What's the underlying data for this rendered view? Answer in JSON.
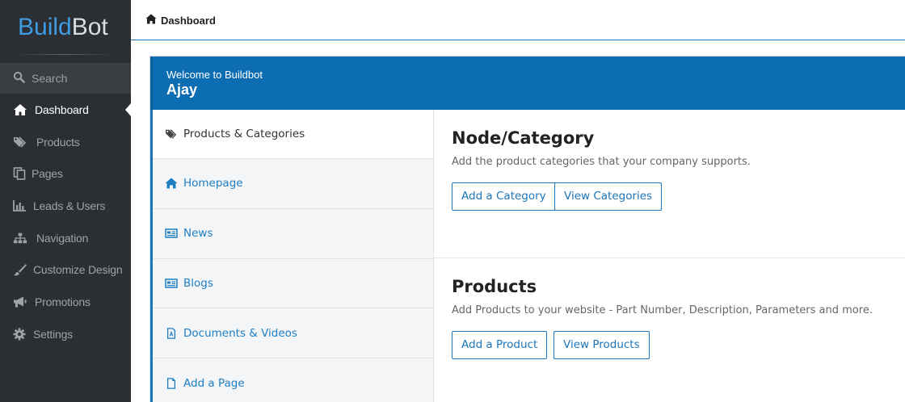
{
  "brand": {
    "part1": "Build",
    "part2": "Bot"
  },
  "colors": {
    "accent": "#1b75bb",
    "header": "#0c6db2",
    "sidebar": "#2b2e33"
  },
  "sidebar": {
    "search_label": "Search",
    "items": [
      {
        "label": "Dashboard",
        "icon": "home-icon",
        "active": true
      },
      {
        "label": "Products",
        "icon": "tags-icon"
      },
      {
        "label": "Pages",
        "icon": "copy-icon"
      },
      {
        "label": "Leads & Users",
        "icon": "bar-chart-icon"
      },
      {
        "label": "Navigation",
        "icon": "sitemap-icon"
      },
      {
        "label": "Customize Design",
        "icon": "brush-icon"
      },
      {
        "label": "Promotions",
        "icon": "megaphone-icon"
      },
      {
        "label": "Settings",
        "icon": "gear-icon"
      }
    ]
  },
  "breadcrumb": {
    "label": "Dashboard",
    "icon": "home-icon"
  },
  "welcome": {
    "greeting": "Welcome to Buildbot",
    "user": "Ajay"
  },
  "tabs": [
    {
      "label": "Products & Categories",
      "icon": "tags-icon",
      "active": true
    },
    {
      "label": "Homepage",
      "icon": "home-icon"
    },
    {
      "label": "News",
      "icon": "newspaper-icon"
    },
    {
      "label": "Blogs",
      "icon": "newspaper-icon"
    },
    {
      "label": "Documents & Videos",
      "icon": "pdf-file-icon"
    },
    {
      "label": "Add a Page",
      "icon": "file-icon"
    }
  ],
  "sections": [
    {
      "title": "Node/Category",
      "description": "Add the product categories that your company supports.",
      "buttons": [
        "Add a Category",
        "View Categories"
      ]
    },
    {
      "title": "Products",
      "description": "Add Products to your website - Part Number, Description, Parameters and more.",
      "buttons": [
        "Add a Product",
        "View Products"
      ]
    }
  ]
}
